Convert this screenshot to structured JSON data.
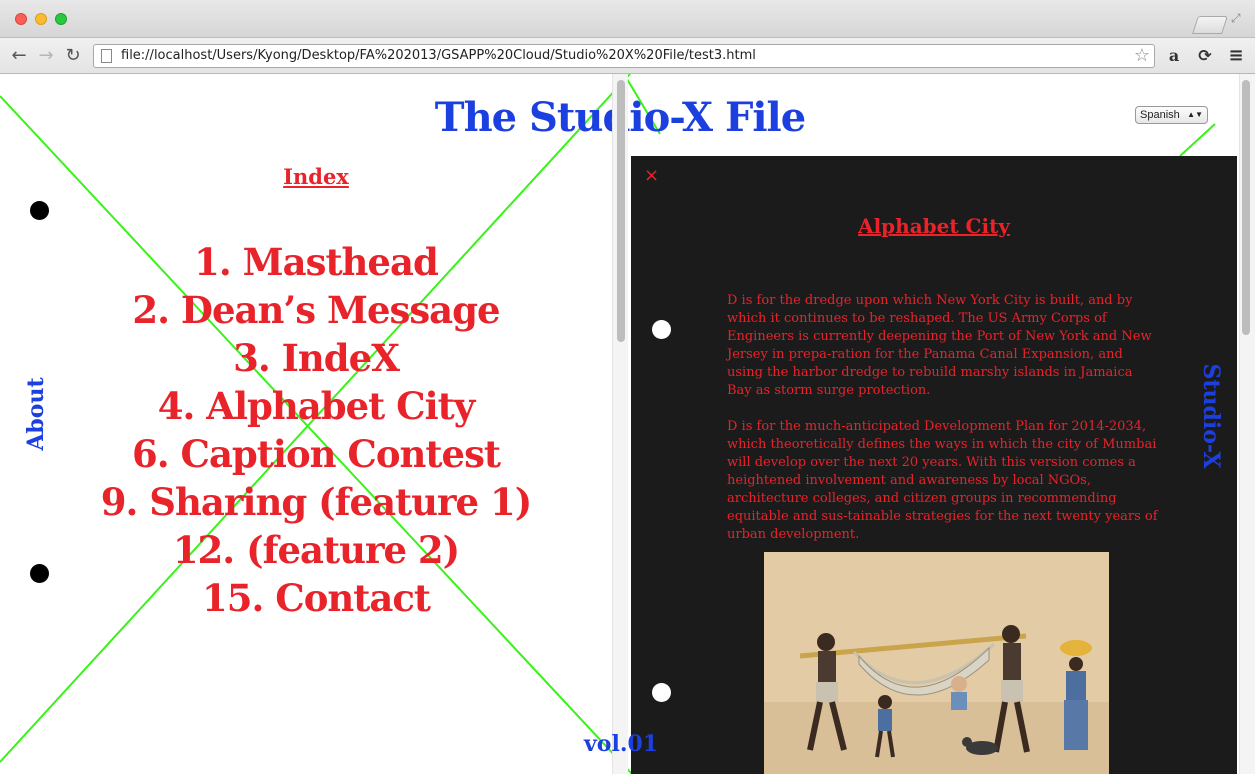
{
  "browser": {
    "url": "file://localhost/Users/Kyong/Desktop/FA%202013/GSAPP%20Cloud/Studio%20X%20File/test3.html",
    "back_icon": "←",
    "forward_icon": "→",
    "reload_icon": "↻",
    "star_icon": "☆",
    "amazon_label": "a",
    "sync_icon": "⟳",
    "menu_icon": "≡"
  },
  "page": {
    "title": "The Studio-X File",
    "language_select": {
      "selected": "Spanish"
    },
    "index_heading": "Index",
    "toc": [
      "1. Masthead",
      "2. Dean’s Message",
      "3. IndeX",
      "4. Alphabet City",
      "6. Caption Contest",
      "9. Sharing (feature 1)",
      "12. (feature 2)",
      "15. Contact"
    ],
    "side_left": "About",
    "side_right": "Studio-X",
    "volume": "vol.01",
    "colors": {
      "red": "#e8232a",
      "blue": "#1c3fe0",
      "green_lines": "#39f21a",
      "panel_bg": "#1c1b1c"
    }
  },
  "panel": {
    "close_label": "×",
    "title": "Alphabet City",
    "paragraphs": [
      "D is for the dredge upon which New York City is built, and by which it continues to be reshaped. The US Army Corps of Engineers is currently deepening the Port of New York and New Jersey in prepa-ration for the Panama Canal Expansion, and using the harbor dredge to rebuild marshy islands in Jamaica Bay as storm surge protection.",
      "D is for the much-anticipated Development Plan for 2014-2034, which theoretically defines the ways in which the city of Mumbai will develop over the next 20 years. With this version comes a heightened involvement and awareness by local NGOs, architecture colleges, and citizen groups in recommending equitable and sus-tainable strategies for the next twenty years of urban development."
    ]
  }
}
